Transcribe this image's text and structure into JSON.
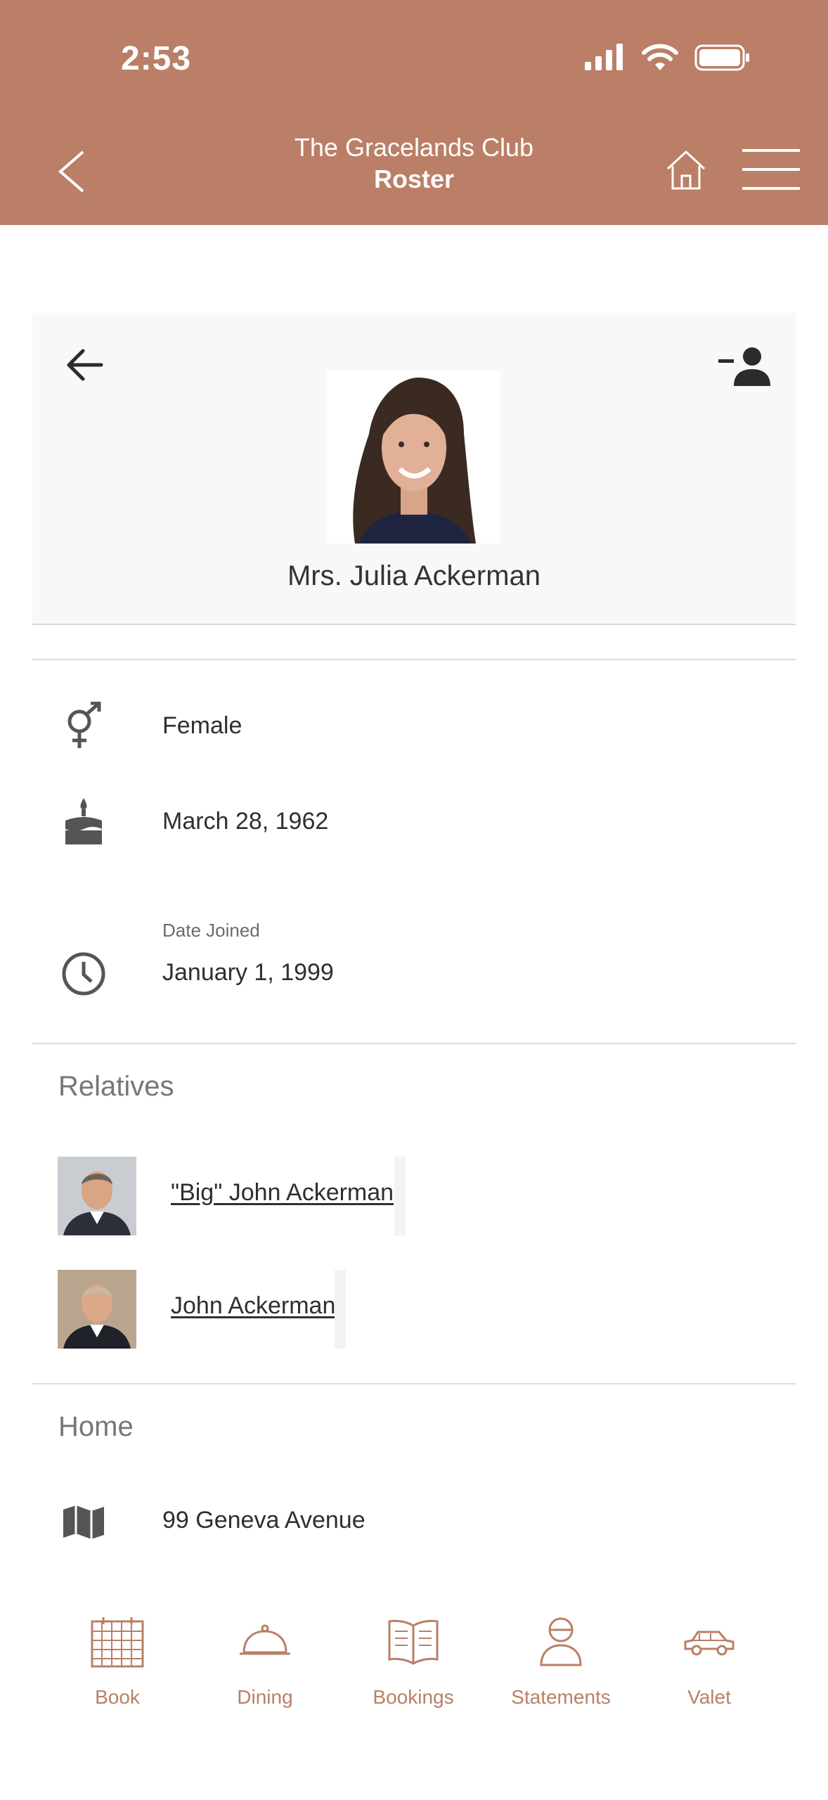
{
  "status_bar": {
    "time": "2:53"
  },
  "header": {
    "club_name": "The Gracelands Club",
    "section": "Roster"
  },
  "profile": {
    "name": "Mrs. Julia Ackerman"
  },
  "details": {
    "gender": "Female",
    "birthday": "March 28, 1962",
    "date_joined_label": "Date Joined",
    "date_joined": "January 1, 1999"
  },
  "relatives": {
    "title": "Relatives",
    "items": [
      {
        "name": "\"Big\" John Ackerman"
      },
      {
        "name": "John Ackerman"
      }
    ]
  },
  "home": {
    "title": "Home",
    "address": "99 Geneva Avenue"
  },
  "bottom_nav": {
    "items": [
      {
        "label": "Book",
        "icon": "calendar-grid-icon"
      },
      {
        "label": "Dining",
        "icon": "cloche-icon"
      },
      {
        "label": "Bookings",
        "icon": "open-book-icon"
      },
      {
        "label": "Statements",
        "icon": "person-icon"
      },
      {
        "label": "Valet",
        "icon": "car-icon"
      }
    ]
  },
  "colors": {
    "brand": "#BA7F66",
    "card_bg": "#F8F8F8",
    "text": "#2F2F2F"
  }
}
